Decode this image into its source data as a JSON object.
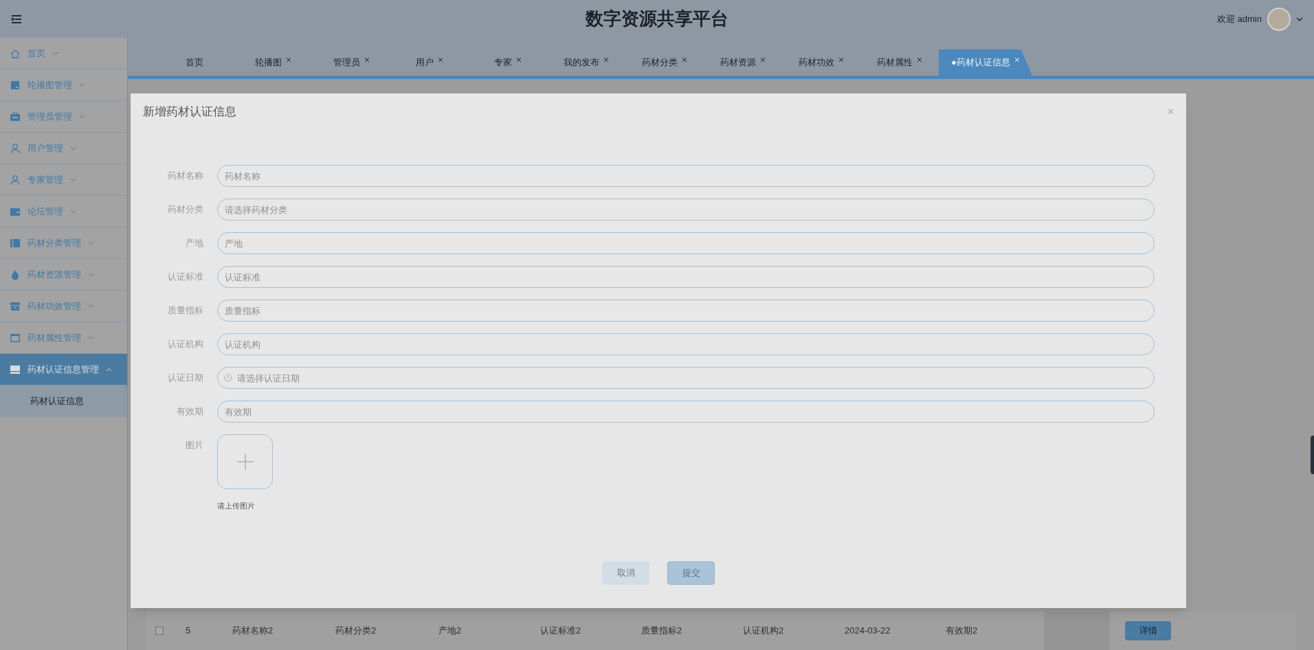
{
  "header": {
    "title": "数字资源共享平台",
    "welcome": "欢迎 admin"
  },
  "sidebar": {
    "items": [
      {
        "label": "首页",
        "expanded": false,
        "selected": false
      },
      {
        "label": "轮播图管理",
        "expanded": false,
        "selected": false
      },
      {
        "label": "管理员管理",
        "expanded": false,
        "selected": false
      },
      {
        "label": "用户管理",
        "expanded": false,
        "selected": false
      },
      {
        "label": "专家管理",
        "expanded": false,
        "selected": false
      },
      {
        "label": "论坛管理",
        "expanded": false,
        "selected": false
      },
      {
        "label": "药材分类管理",
        "expanded": false,
        "selected": false
      },
      {
        "label": "药材资源管理",
        "expanded": false,
        "selected": false
      },
      {
        "label": "药材功效管理",
        "expanded": false,
        "selected": false
      },
      {
        "label": "药材属性管理",
        "expanded": false,
        "selected": false
      },
      {
        "label": "药材认证信息管理",
        "expanded": true,
        "selected": true,
        "children": [
          {
            "label": "药材认证信息"
          }
        ]
      }
    ]
  },
  "tabs": [
    {
      "label": "首页",
      "closable": false,
      "selected": false
    },
    {
      "label": "轮播图",
      "closable": true,
      "selected": false
    },
    {
      "label": "管理员",
      "closable": true,
      "selected": false
    },
    {
      "label": "用户",
      "closable": true,
      "selected": false
    },
    {
      "label": "专家",
      "closable": true,
      "selected": false
    },
    {
      "label": "我的发布",
      "closable": true,
      "selected": false
    },
    {
      "label": "药材分类",
      "closable": true,
      "selected": false
    },
    {
      "label": "药材资源",
      "closable": true,
      "selected": false
    },
    {
      "label": "药材功效",
      "closable": true,
      "selected": false
    },
    {
      "label": "药材属性",
      "closable": true,
      "selected": false
    },
    {
      "label": "●药材认证信息",
      "closable": true,
      "selected": true
    }
  ],
  "table": {
    "rows": [
      {
        "checked": false,
        "cells": [
          "5",
          "药材名称2",
          "药材分类2",
          "产地2",
          "认证标准2",
          "质量指标2",
          "认证机构2",
          "2024-03-22",
          "有效期2"
        ],
        "action": "详情"
      }
    ]
  },
  "dialog": {
    "title": "新增药材认证信息",
    "close": "×",
    "fields": [
      {
        "kind": "input",
        "label": "药材名称",
        "placeholder": "药材名称"
      },
      {
        "kind": "select",
        "label": "药材分类",
        "placeholder": "请选择药材分类"
      },
      {
        "kind": "input",
        "label": "产地",
        "placeholder": "产地"
      },
      {
        "kind": "input",
        "label": "认证标准",
        "placeholder": "认证标准"
      },
      {
        "kind": "input",
        "label": "质量指标",
        "placeholder": "质量指标"
      },
      {
        "kind": "input",
        "label": "认证机构",
        "placeholder": "认证机构"
      },
      {
        "kind": "date",
        "label": "认证日期",
        "placeholder": "请选择认证日期"
      },
      {
        "kind": "input",
        "label": "有效期",
        "placeholder": "有效期"
      },
      {
        "kind": "upload",
        "label": "图片",
        "hint": "请上传图片"
      }
    ],
    "buttons": [
      {
        "label": "取消",
        "primary": false
      },
      {
        "label": "提交",
        "primary": true
      }
    ]
  }
}
